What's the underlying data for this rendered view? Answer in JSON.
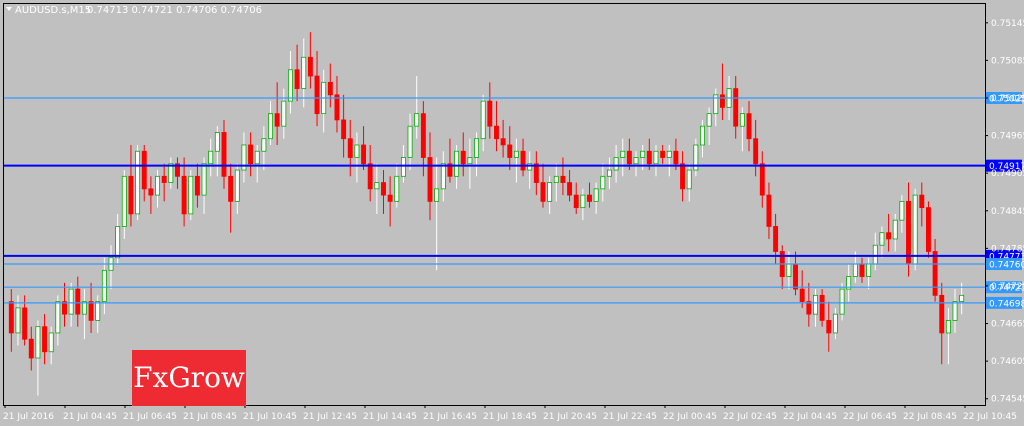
{
  "header": {
    "symbol_label": "AUDUSD.s,M15",
    "ohlc_label": "0.74713 0.74721 0.74706 0.74706",
    "menu_icon": "triangle-down-icon"
  },
  "logo": {
    "text": "FxGrow",
    "bg_color": "#ee2a33"
  },
  "colors": {
    "background": "#c0c0c0",
    "bull_body": "#ffffff",
    "bear_body": "#ff0000",
    "bull_border": "#00aa00",
    "wick": "#ffffff",
    "light_line": "#3399ff",
    "dark_line": "#0000ff",
    "axis_text": "#ffffff"
  },
  "chart_data": {
    "type": "candlestick",
    "y_range": [
      0.74535,
      0.75175
    ],
    "y_ticks": [
      "0.75145",
      "0.75085",
      "0.75025",
      "0.74965",
      "0.74905",
      "0.74845",
      "0.74785",
      "0.74725",
      "0.74665",
      "0.74605",
      "0.74545"
    ],
    "x_ticks": [
      "21 Jul 2016",
      "21 Jul 04:45",
      "21 Jul 06:45",
      "21 Jul 08:45",
      "21 Jul 10:45",
      "21 Jul 12:45",
      "21 Jul 14:45",
      "21 Jul 16:45",
      "21 Jul 18:45",
      "21 Jul 20:45",
      "21 Jul 22:45",
      "22 Jul 00:45",
      "22 Jul 02:45",
      "22 Jul 04:45",
      "22 Jul 06:45",
      "22 Jul 08:45",
      "22 Jul 10:45"
    ],
    "horizontal_lines": [
      {
        "price": 0.75025,
        "label": "0.75025",
        "style": "light"
      },
      {
        "price": 0.74917,
        "label": "0.74917",
        "style": "dark"
      },
      {
        "price": 0.74773,
        "label": "0.74773",
        "style": "dark"
      },
      {
        "price": 0.7476,
        "label": "0.74760",
        "style": "light"
      },
      {
        "price": 0.74723,
        "label": "0.74723",
        "style": "light"
      },
      {
        "price": 0.74698,
        "label": "0.74698",
        "style": "light"
      }
    ],
    "candles": [
      [
        0.747,
        0.7472,
        0.7462,
        0.7465
      ],
      [
        0.7465,
        0.7471,
        0.7463,
        0.7469
      ],
      [
        0.7469,
        0.7471,
        0.7463,
        0.7464
      ],
      [
        0.7464,
        0.7466,
        0.7459,
        0.7461
      ],
      [
        0.7461,
        0.7467,
        0.7455,
        0.7466
      ],
      [
        0.7466,
        0.7468,
        0.746,
        0.7462
      ],
      [
        0.7462,
        0.7466,
        0.746,
        0.7465
      ],
      [
        0.7465,
        0.7471,
        0.7463,
        0.747
      ],
      [
        0.747,
        0.7473,
        0.7466,
        0.7468
      ],
      [
        0.7468,
        0.7473,
        0.7466,
        0.7472
      ],
      [
        0.7472,
        0.7474,
        0.7466,
        0.7468
      ],
      [
        0.7468,
        0.7472,
        0.7464,
        0.747
      ],
      [
        0.747,
        0.7473,
        0.7465,
        0.7467
      ],
      [
        0.7467,
        0.7471,
        0.7465,
        0.747
      ],
      [
        0.747,
        0.7477,
        0.7468,
        0.7475
      ],
      [
        0.7475,
        0.7479,
        0.7472,
        0.7477
      ],
      [
        0.7477,
        0.7484,
        0.7476,
        0.7482
      ],
      [
        0.7482,
        0.7491,
        0.748,
        0.749
      ],
      [
        0.749,
        0.7495,
        0.7482,
        0.7484
      ],
      [
        0.7484,
        0.7495,
        0.7483,
        0.7494
      ],
      [
        0.7494,
        0.7495,
        0.7486,
        0.7488
      ],
      [
        0.7488,
        0.749,
        0.7484,
        0.7487
      ],
      [
        0.7487,
        0.7491,
        0.7485,
        0.749
      ],
      [
        0.749,
        0.7492,
        0.7486,
        0.7489
      ],
      [
        0.7489,
        0.7493,
        0.7488,
        0.7492
      ],
      [
        0.7492,
        0.7493,
        0.7488,
        0.749
      ],
      [
        0.749,
        0.7493,
        0.7482,
        0.7484
      ],
      [
        0.7484,
        0.7491,
        0.7483,
        0.749
      ],
      [
        0.749,
        0.7492,
        0.7485,
        0.7487
      ],
      [
        0.7487,
        0.7493,
        0.7484,
        0.7492
      ],
      [
        0.7492,
        0.7496,
        0.749,
        0.7494
      ],
      [
        0.7494,
        0.7498,
        0.749,
        0.7497
      ],
      [
        0.7497,
        0.7499,
        0.7488,
        0.749
      ],
      [
        0.749,
        0.7492,
        0.7481,
        0.7486
      ],
      [
        0.7486,
        0.7492,
        0.7484,
        0.7491
      ],
      [
        0.7491,
        0.7497,
        0.7489,
        0.7495
      ],
      [
        0.7495,
        0.7497,
        0.749,
        0.7492
      ],
      [
        0.7492,
        0.7495,
        0.7489,
        0.7494
      ],
      [
        0.7494,
        0.7498,
        0.7491,
        0.7496
      ],
      [
        0.7496,
        0.7502,
        0.7495,
        0.75
      ],
      [
        0.75,
        0.7505,
        0.7495,
        0.7498
      ],
      [
        0.7498,
        0.7504,
        0.7496,
        0.7502
      ],
      [
        0.7502,
        0.751,
        0.75,
        0.7507
      ],
      [
        0.7507,
        0.7511,
        0.7502,
        0.7504
      ],
      [
        0.7504,
        0.7512,
        0.7501,
        0.7509
      ],
      [
        0.7509,
        0.7513,
        0.7504,
        0.7506
      ],
      [
        0.7506,
        0.751,
        0.7498,
        0.75
      ],
      [
        0.75,
        0.7507,
        0.7497,
        0.7505
      ],
      [
        0.7505,
        0.7508,
        0.7501,
        0.7503
      ],
      [
        0.7503,
        0.7506,
        0.7497,
        0.7499
      ],
      [
        0.7499,
        0.7503,
        0.7493,
        0.7496
      ],
      [
        0.7496,
        0.7499,
        0.749,
        0.7493
      ],
      [
        0.7493,
        0.7497,
        0.7489,
        0.7495
      ],
      [
        0.7495,
        0.7498,
        0.7491,
        0.7492
      ],
      [
        0.7492,
        0.7495,
        0.7486,
        0.7488
      ],
      [
        0.7488,
        0.7492,
        0.7484,
        0.7489
      ],
      [
        0.7489,
        0.7491,
        0.7484,
        0.7487
      ],
      [
        0.7487,
        0.749,
        0.7482,
        0.7486
      ],
      [
        0.7486,
        0.7492,
        0.7485,
        0.749
      ],
      [
        0.749,
        0.7495,
        0.7489,
        0.7493
      ],
      [
        0.7493,
        0.75,
        0.7491,
        0.7498
      ],
      [
        0.7498,
        0.7506,
        0.7496,
        0.75
      ],
      [
        0.75,
        0.7502,
        0.749,
        0.7493
      ],
      [
        0.7493,
        0.7497,
        0.7483,
        0.7486
      ],
      [
        0.7486,
        0.7493,
        0.7475,
        0.7488
      ],
      [
        0.7488,
        0.7494,
        0.7486,
        0.7492
      ],
      [
        0.7492,
        0.7496,
        0.7489,
        0.749
      ],
      [
        0.749,
        0.7495,
        0.7488,
        0.7494
      ],
      [
        0.7494,
        0.7497,
        0.749,
        0.7492
      ],
      [
        0.7492,
        0.7496,
        0.7488,
        0.7493
      ],
      [
        0.7493,
        0.7497,
        0.749,
        0.7496
      ],
      [
        0.7496,
        0.7503,
        0.7494,
        0.7502
      ],
      [
        0.7502,
        0.7505,
        0.7496,
        0.7498
      ],
      [
        0.7498,
        0.7502,
        0.7494,
        0.7496
      ],
      [
        0.7496,
        0.7499,
        0.7493,
        0.7495
      ],
      [
        0.7495,
        0.7498,
        0.7491,
        0.7493
      ],
      [
        0.7493,
        0.7496,
        0.7489,
        0.7494
      ],
      [
        0.7494,
        0.7496,
        0.749,
        0.7491
      ],
      [
        0.7491,
        0.7494,
        0.7488,
        0.7492
      ],
      [
        0.7492,
        0.7494,
        0.7487,
        0.7489
      ],
      [
        0.7489,
        0.7492,
        0.7485,
        0.7486
      ],
      [
        0.7486,
        0.749,
        0.7484,
        0.7489
      ],
      [
        0.7489,
        0.7492,
        0.7486,
        0.749
      ],
      [
        0.749,
        0.7493,
        0.7487,
        0.7489
      ],
      [
        0.7489,
        0.7491,
        0.7486,
        0.7487
      ],
      [
        0.7487,
        0.7489,
        0.7484,
        0.7485
      ],
      [
        0.7485,
        0.7488,
        0.7483,
        0.7487
      ],
      [
        0.7487,
        0.7489,
        0.7485,
        0.7486
      ],
      [
        0.7486,
        0.7489,
        0.7484,
        0.7488
      ],
      [
        0.7488,
        0.7492,
        0.7486,
        0.749
      ],
      [
        0.749,
        0.7493,
        0.7488,
        0.7491
      ],
      [
        0.7491,
        0.7495,
        0.7489,
        0.7493
      ],
      [
        0.7493,
        0.7496,
        0.749,
        0.7494
      ],
      [
        0.7494,
        0.7496,
        0.7491,
        0.7492
      ],
      [
        0.7492,
        0.7494,
        0.749,
        0.7493
      ],
      [
        0.7493,
        0.7495,
        0.7491,
        0.7494
      ],
      [
        0.7494,
        0.7496,
        0.7491,
        0.7492
      ],
      [
        0.7492,
        0.7495,
        0.749,
        0.7494
      ],
      [
        0.7494,
        0.7495,
        0.7492,
        0.7493
      ],
      [
        0.7493,
        0.7495,
        0.749,
        0.7494
      ],
      [
        0.7494,
        0.7496,
        0.7491,
        0.7492
      ],
      [
        0.7492,
        0.7494,
        0.7486,
        0.7488
      ],
      [
        0.7488,
        0.7492,
        0.7486,
        0.7491
      ],
      [
        0.7491,
        0.7496,
        0.749,
        0.7495
      ],
      [
        0.7495,
        0.7499,
        0.7493,
        0.7498
      ],
      [
        0.7498,
        0.7501,
        0.7495,
        0.75
      ],
      [
        0.75,
        0.7504,
        0.7498,
        0.7503
      ],
      [
        0.7503,
        0.7508,
        0.7499,
        0.7501
      ],
      [
        0.7501,
        0.7506,
        0.7499,
        0.7504
      ],
      [
        0.7504,
        0.7506,
        0.7496,
        0.7498
      ],
      [
        0.7498,
        0.7501,
        0.7494,
        0.75
      ],
      [
        0.75,
        0.7502,
        0.7494,
        0.7496
      ],
      [
        0.7496,
        0.7499,
        0.749,
        0.7492
      ],
      [
        0.7492,
        0.7494,
        0.7485,
        0.7487
      ],
      [
        0.7487,
        0.7489,
        0.748,
        0.7482
      ],
      [
        0.7482,
        0.7484,
        0.7476,
        0.7478
      ],
      [
        0.7478,
        0.7479,
        0.7472,
        0.7474
      ],
      [
        0.7474,
        0.7478,
        0.7472,
        0.7476
      ],
      [
        0.7476,
        0.7478,
        0.7471,
        0.7472
      ],
      [
        0.7472,
        0.7475,
        0.7469,
        0.747
      ],
      [
        0.747,
        0.7473,
        0.7466,
        0.7468
      ],
      [
        0.7468,
        0.7472,
        0.7466,
        0.7471
      ],
      [
        0.7471,
        0.7472,
        0.7466,
        0.7467
      ],
      [
        0.7467,
        0.747,
        0.7462,
        0.7465
      ],
      [
        0.7465,
        0.7469,
        0.7464,
        0.7468
      ],
      [
        0.7468,
        0.7473,
        0.7467,
        0.7472
      ],
      [
        0.7472,
        0.7476,
        0.747,
        0.7474
      ],
      [
        0.7474,
        0.7478,
        0.7473,
        0.7476
      ],
      [
        0.7476,
        0.7477,
        0.7473,
        0.7474
      ],
      [
        0.7474,
        0.7477,
        0.7472,
        0.7476
      ],
      [
        0.7476,
        0.7481,
        0.7475,
        0.7479
      ],
      [
        0.7479,
        0.7482,
        0.7477,
        0.7481
      ],
      [
        0.7481,
        0.7484,
        0.7478,
        0.748
      ],
      [
        0.748,
        0.7484,
        0.7478,
        0.7483
      ],
      [
        0.7483,
        0.7487,
        0.7481,
        0.7486
      ],
      [
        0.7486,
        0.7489,
        0.7474,
        0.7476
      ],
      [
        0.7476,
        0.7488,
        0.7475,
        0.7487
      ],
      [
        0.7487,
        0.7489,
        0.7482,
        0.7485
      ],
      [
        0.7485,
        0.7486,
        0.7477,
        0.7478
      ],
      [
        0.7478,
        0.748,
        0.747,
        0.7471
      ],
      [
        0.7471,
        0.7473,
        0.746,
        0.7465
      ],
      [
        0.7465,
        0.7469,
        0.746,
        0.7467
      ],
      [
        0.7467,
        0.7472,
        0.7465,
        0.747
      ],
      [
        0.747,
        0.7473,
        0.7468,
        0.7471
      ]
    ]
  }
}
